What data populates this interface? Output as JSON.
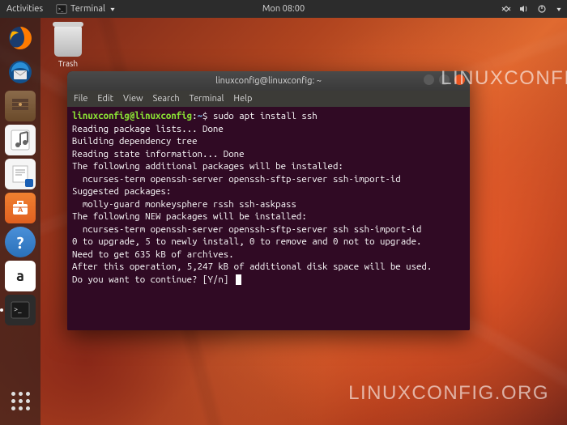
{
  "topbar": {
    "activities": "Activities",
    "app_name": "Terminal",
    "clock": "Mon 08:00"
  },
  "desktop": {
    "trash_label": "Trash"
  },
  "dock": {
    "items": [
      {
        "name": "firefox"
      },
      {
        "name": "thunderbird"
      },
      {
        "name": "files"
      },
      {
        "name": "rhythmbox"
      },
      {
        "name": "libreoffice-writer"
      },
      {
        "name": "ubuntu-software"
      },
      {
        "name": "help"
      },
      {
        "name": "amazon"
      },
      {
        "name": "terminal"
      }
    ]
  },
  "window": {
    "title": "linuxconfig@linuxconfig: ~",
    "menu": [
      "File",
      "Edit",
      "View",
      "Search",
      "Terminal",
      "Help"
    ]
  },
  "terminal": {
    "prompt_user": "linuxconfig@linuxconfig",
    "prompt_path": "~",
    "prompt_sep": ":",
    "prompt_end": "$",
    "command": "sudo apt install ssh",
    "lines": [
      "Reading package lists... Done",
      "Building dependency tree",
      "Reading state information... Done",
      "The following additional packages will be installed:",
      "  ncurses-term openssh-server openssh-sftp-server ssh-import-id",
      "Suggested packages:",
      "  molly-guard monkeysphere rssh ssh-askpass",
      "The following NEW packages will be installed:",
      "  ncurses-term openssh-server openssh-sftp-server ssh ssh-import-id",
      "0 to upgrade, 5 to newly install, 0 to remove and 0 not to upgrade.",
      "Need to get 635 kB of archives.",
      "After this operation, 5,247 kB of additional disk space will be used.",
      "Do you want to continue? [Y/n] "
    ]
  },
  "watermark": "LINUXCONFIG.ORG"
}
